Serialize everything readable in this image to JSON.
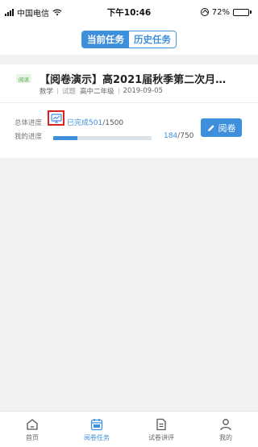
{
  "status_bar": {
    "carrier": "中国电信",
    "time": "下午10:46",
    "battery": "72%",
    "battery_level": 0.72
  },
  "header": {
    "tabs": [
      {
        "label": "当前任务",
        "active": true
      },
      {
        "label": "历史任务",
        "active": false
      }
    ]
  },
  "task_card": {
    "tag": "阅读",
    "title": "【阅卷演示】高2021届秋季第二次月…",
    "subject": "数学",
    "type_label": "试题",
    "grade": "高中二年级",
    "date": "2019-09-05",
    "total_progress_label": "总体进度",
    "completed_prefix": "已完成",
    "completed_count": "501",
    "total_count": "/1500",
    "my_progress_label": "我的进度",
    "my_done": "184",
    "my_total": "/750",
    "my_progress_fraction": 0.245,
    "read_button_label": "阅卷"
  },
  "bottom_nav": [
    {
      "label": "首页",
      "icon": "home-icon",
      "active": false
    },
    {
      "label": "阅卷任务",
      "icon": "calendar-icon",
      "active": true
    },
    {
      "label": "试卷讲评",
      "icon": "document-icon",
      "active": false
    },
    {
      "label": "我的",
      "icon": "person-icon",
      "active": false
    }
  ],
  "colors": {
    "accent": "#3d8fdb",
    "highlight_box": "#e02020",
    "tag_green": "#5aa85a"
  }
}
